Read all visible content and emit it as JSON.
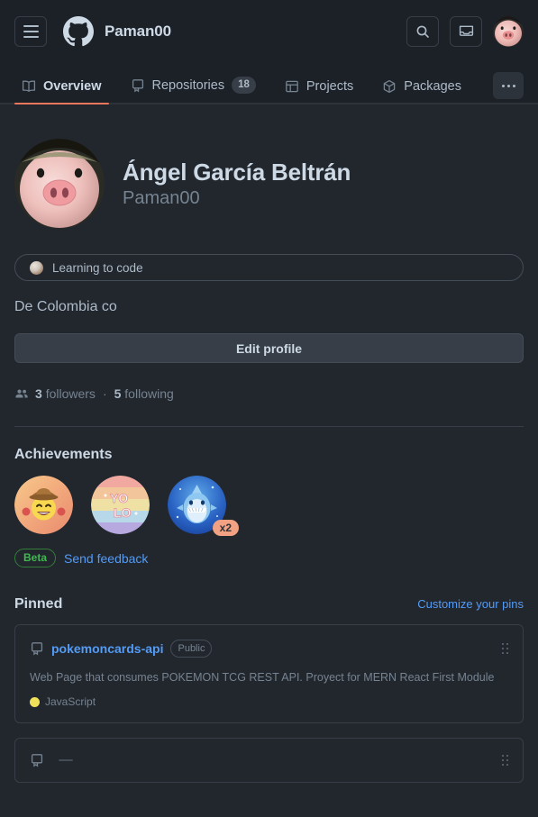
{
  "header": {
    "menu_icon": "hamburger-menu-icon",
    "logo_icon": "github-logo-icon",
    "username": "Paman00",
    "search_icon": "search-icon",
    "inbox_icon": "inbox-icon",
    "avatar_icon": "user-avatar"
  },
  "tabs": [
    {
      "label": "Overview",
      "icon": "book-icon",
      "count": null,
      "selected": true
    },
    {
      "label": "Repositories",
      "icon": "repo-icon",
      "count": "18",
      "selected": false
    },
    {
      "label": "Projects",
      "icon": "table-icon",
      "count": null,
      "selected": false
    },
    {
      "label": "Packages",
      "icon": "package-icon",
      "count": null,
      "selected": false
    }
  ],
  "tab_overflow_label": "More",
  "profile": {
    "full_name": "Ángel García Beltrán",
    "username": "Paman00",
    "status_emoji": "rock-emoji",
    "status_text": "Learning to code",
    "bio": "De Colombia co",
    "edit_button": "Edit profile",
    "followers_icon": "people-icon",
    "followers_count": "3",
    "followers_label": "followers",
    "separator": "·",
    "following_count": "5",
    "following_label": "following"
  },
  "achievements": {
    "title": "Achievements",
    "badges": [
      {
        "name": "quickdraw-badge",
        "multiplier": null
      },
      {
        "name": "yolo-badge",
        "multiplier": null
      },
      {
        "name": "pull-shark-badge",
        "multiplier": "x2"
      }
    ],
    "beta_label": "Beta",
    "feedback_label": "Send feedback"
  },
  "pinned": {
    "title": "Pinned",
    "customize_link": "Customize your pins",
    "repos": [
      {
        "name": "pokemoncards-api",
        "visibility": "Public",
        "description": "Web Page that consumes POKEMON TCG REST API. Proyect for MERN React First Module",
        "language": "JavaScript",
        "language_color": "#f1e05a"
      },
      {
        "name": "",
        "visibility": "",
        "description": "",
        "language": "",
        "language_color": "#f1e05a"
      }
    ]
  },
  "colors": {
    "page_bg": "#22272e",
    "header_bg": "#1c2128",
    "border": "#373e47",
    "accent_underline": "#ec775c",
    "link": "#539bf5",
    "text": "#adbac7",
    "muted": "#768390",
    "green": "#3fb950"
  }
}
